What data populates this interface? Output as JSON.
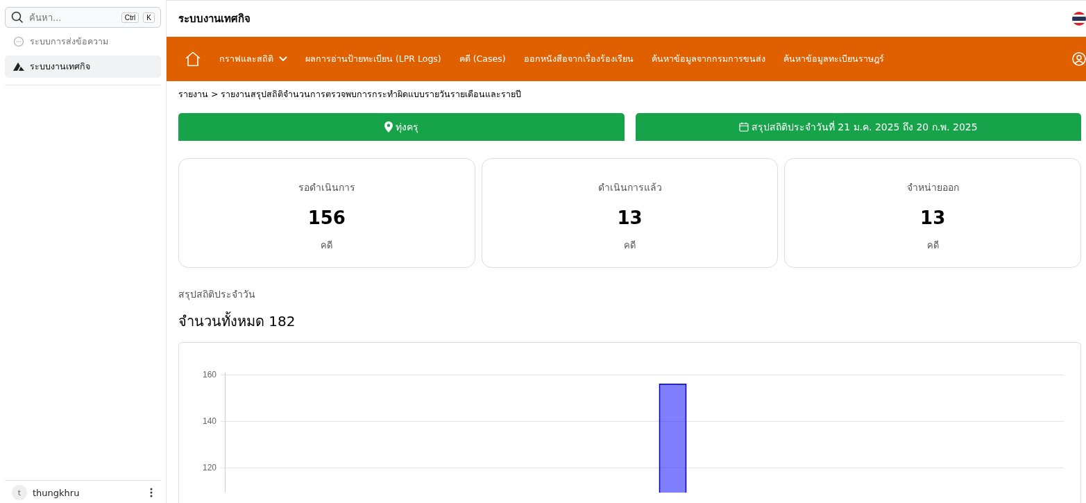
{
  "sidebar": {
    "search": {
      "placeholder": "ค้นหา...",
      "keys": [
        "Ctrl",
        "K"
      ]
    },
    "items": [
      {
        "label": "ระบบการส่งข้อความ",
        "kind": "chat",
        "selected": false
      },
      {
        "label": "ระบบงานเทศกิจ",
        "kind": "logo",
        "selected": true
      }
    ],
    "user": {
      "initial": "t",
      "name": "thungkhru"
    }
  },
  "header": {
    "title": "ระบบงานเทศกิจ"
  },
  "nav": {
    "items": [
      {
        "label": "กราฟและสถิติ",
        "dropdown": true
      },
      {
        "label": "ผลการอ่านป้ายทะเบียน (LPR Logs)",
        "dropdown": false
      },
      {
        "label": "คดี (Cases)",
        "dropdown": false
      },
      {
        "label": "ออกหนังสือจากเรื่องร้องเรียน",
        "dropdown": false
      },
      {
        "label": "ค้นหาข้อมูลจากกรมการขนส่ง",
        "dropdown": false
      },
      {
        "label": "ค้นหาข้อมูลทะเบียนราษฎร์",
        "dropdown": false
      }
    ]
  },
  "breadcrumb": "รายงาน > รายงานสรุปสถิติจำนวนการตรวจพบการกระทำผิดแบบรายวันรายเดือนและรายปี",
  "filters": [
    {
      "kind": "location",
      "label": "ทุ่งครุ"
    },
    {
      "kind": "date",
      "label": "สรุปสถิติประจำวันที่ 21 ม.ค. 2025 ถึง 20 ก.พ. 2025"
    }
  ],
  "stats": [
    {
      "label": "รอดำเนินการ",
      "value": "156",
      "unit": "คดี"
    },
    {
      "label": "ดำเนินการแล้ว",
      "value": "13",
      "unit": "คดี"
    },
    {
      "label": "จำหน่ายออก",
      "value": "13",
      "unit": "คดี"
    }
  ],
  "summary": {
    "subtitle": "สรุปสถิติประจำวัน",
    "total": "จำนวนทั้งหมด 182",
    "chart_data": {
      "type": "bar",
      "values": [
        156
      ],
      "ylim": [
        108,
        161
      ],
      "yticks": [
        120,
        140,
        160
      ],
      "grid": true
    }
  }
}
